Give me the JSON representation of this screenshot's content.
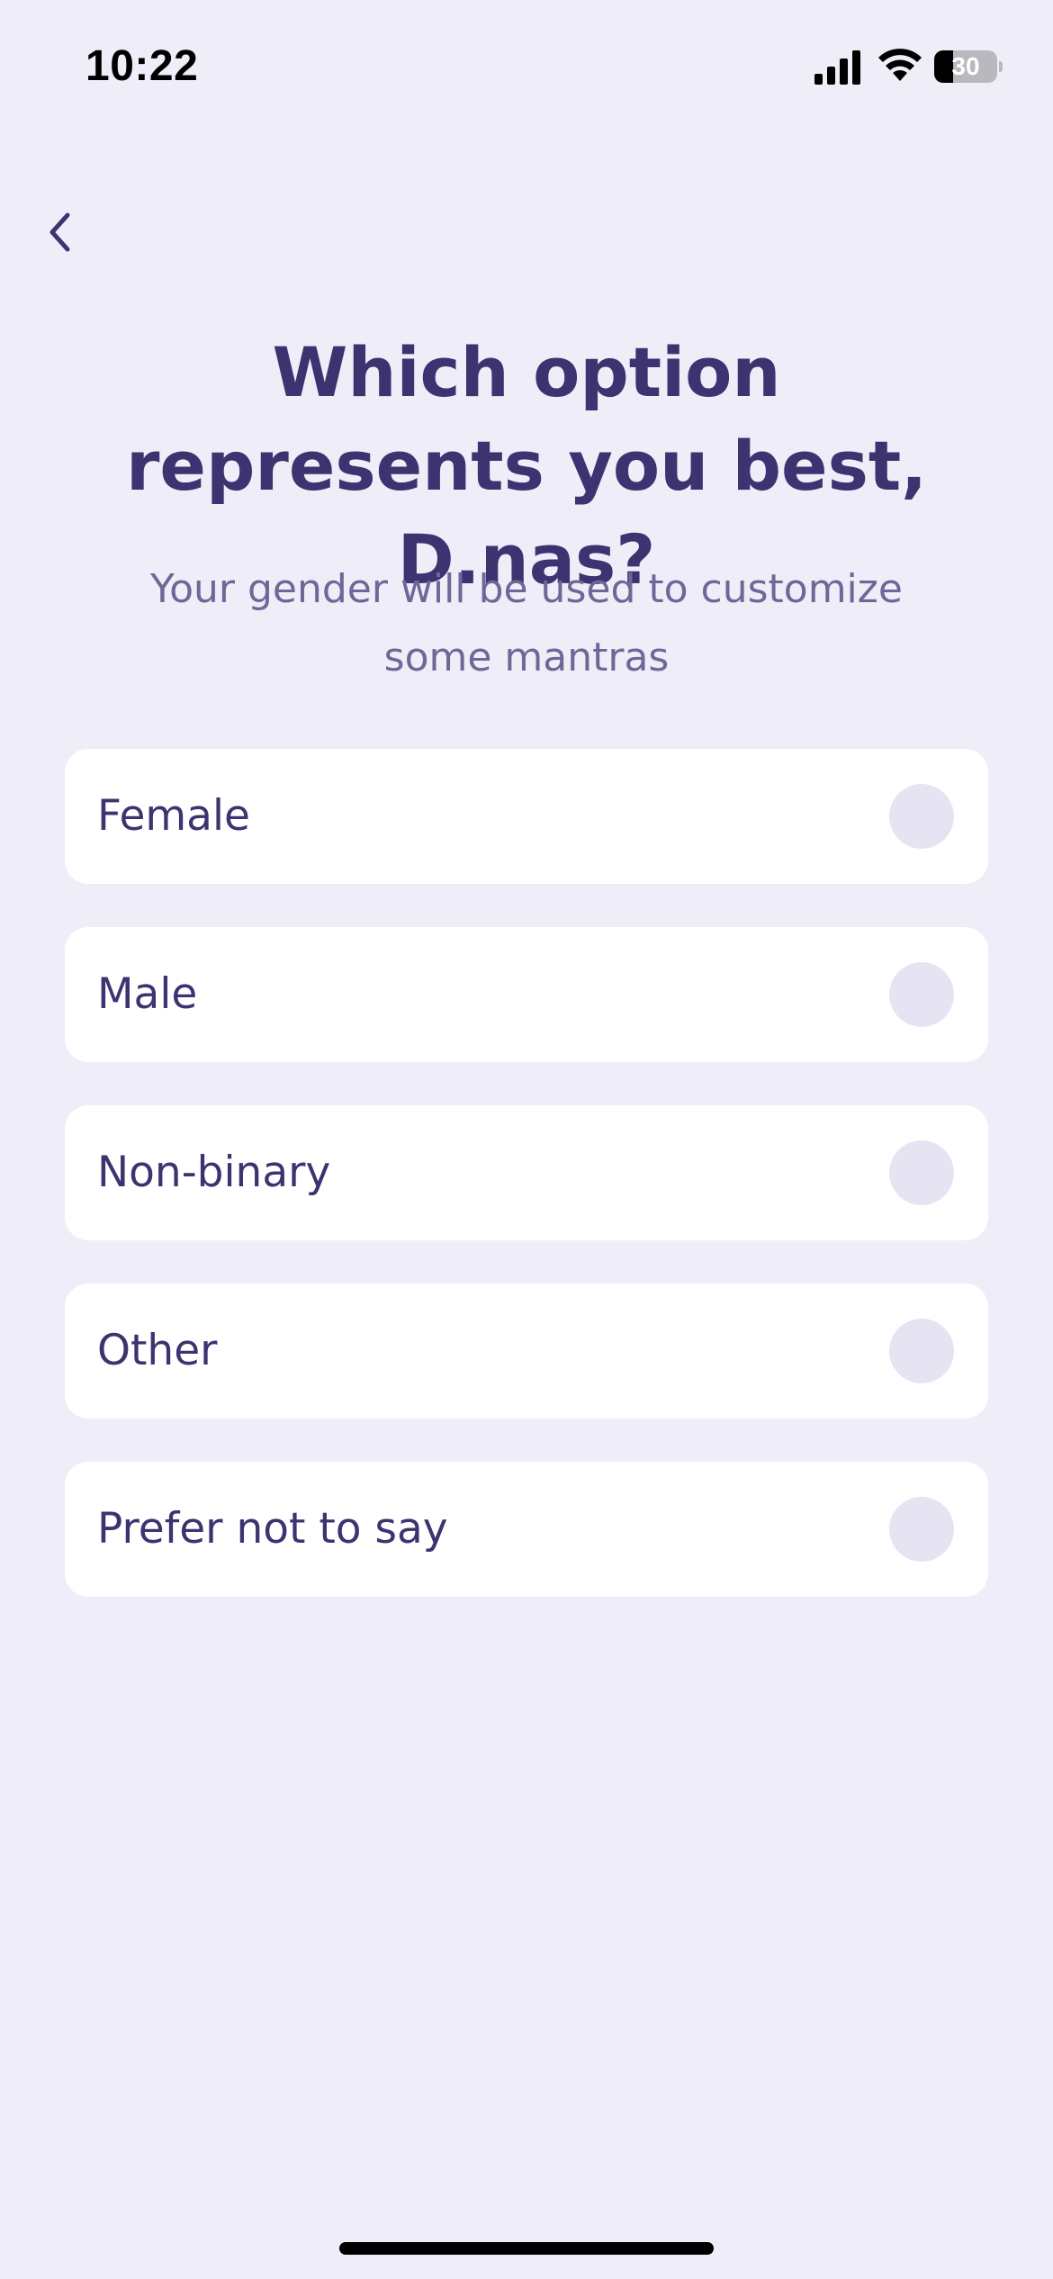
{
  "status_bar": {
    "time": "10:22",
    "battery_text": "30",
    "battery_level": 0.3,
    "signal_icon": "cellular-signal-icon",
    "wifi_icon": "wifi-icon",
    "battery_icon": "battery-icon"
  },
  "nav": {
    "back_icon": "chevron-left-icon"
  },
  "header": {
    "title": "Which option represents you best, D.nas?",
    "subtitle": "Your gender will be used to customize some mantras"
  },
  "options": [
    {
      "label": "Female",
      "selected": false
    },
    {
      "label": "Male",
      "selected": false
    },
    {
      "label": "Non-binary",
      "selected": false
    },
    {
      "label": "Other",
      "selected": false
    },
    {
      "label": "Prefer not to say",
      "selected": false
    }
  ],
  "colors": {
    "background": "#efedf8",
    "primary_text": "#3d3370",
    "secondary_text": "#6f6797",
    "card": "#ffffff",
    "radio_unselected": "#e6e4f3"
  }
}
